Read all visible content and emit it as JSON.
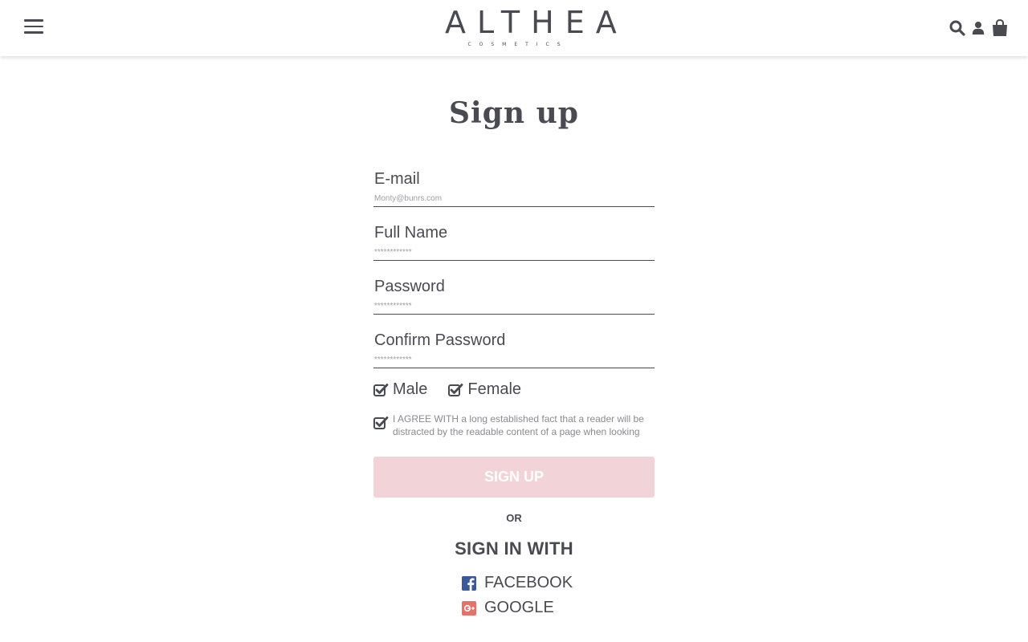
{
  "header": {
    "menu_icon": "hamburger-menu-icon",
    "logo_main": "ALTHEA",
    "logo_sub": "COSMETICS",
    "icons": [
      "search-icon",
      "user-icon",
      "shopping-bag-icon"
    ]
  },
  "page": {
    "title": "Sign up"
  },
  "form": {
    "email": {
      "label": "E-mail",
      "placeholder": "Monty@bunrs.com"
    },
    "full_name": {
      "label": "Full Name",
      "placeholder": "************"
    },
    "password": {
      "label": "Password",
      "placeholder": "************"
    },
    "confirm_password": {
      "label": "Confirm Password",
      "placeholder": "************"
    },
    "gender": {
      "male_label": "Male",
      "female_label": "Female",
      "male_checked": true,
      "female_checked": true
    },
    "agree": {
      "text": "I AGREE WITH a long established fact that a reader will be distracted by the readable content of a page when looking",
      "checked": true
    },
    "signup_label": "SIGN UP",
    "or_label": "OR",
    "sign_in_with_label": "SIGN IN WITH",
    "facebook_label": "FACEBOOK",
    "google_label": "GOOGLE"
  },
  "colors": {
    "text": "#4a4a52",
    "button_bg": "#f2d4d8",
    "facebook": "#3b5998",
    "google": "#db4437"
  }
}
